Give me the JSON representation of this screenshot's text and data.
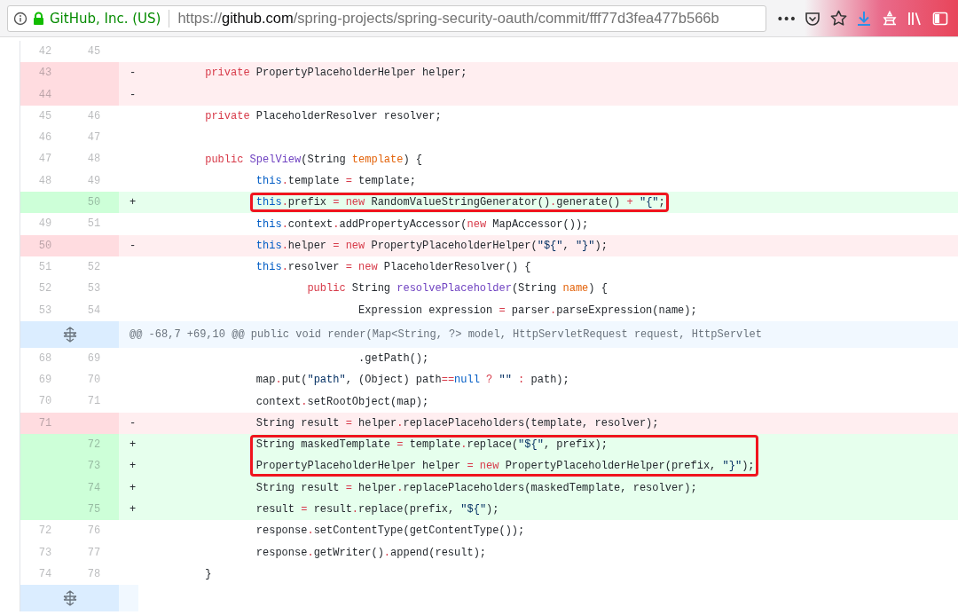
{
  "browser": {
    "site_identity": "GitHub, Inc. (US)",
    "url": "https://**github.com**/spring-projects/spring-security-oauth/commit/fff77d3fea477b566b",
    "menu_glyph": "•••"
  },
  "diff": {
    "lines": [
      {
        "kind": "context",
        "old": "42",
        "new": "45"
      },
      {
        "kind": "del",
        "old": "43",
        "sign": "-",
        "boxed": false,
        "tokens": [
          {
            "kind": "kw",
            "text": "\tprivate"
          },
          {
            "kind": "plain",
            "text": " PropertyPlaceholderHelper helper;"
          }
        ]
      },
      {
        "kind": "del",
        "old": "44",
        "sign": "-"
      },
      {
        "kind": "context",
        "old": "45",
        "new": "46",
        "boxed": false,
        "tokens": [
          {
            "kind": "kw",
            "text": "\tprivate"
          },
          {
            "kind": "plain",
            "text": " PlaceholderResolver resolver;"
          }
        ]
      },
      {
        "kind": "context",
        "old": "46",
        "new": "47"
      },
      {
        "kind": "context",
        "old": "47",
        "new": "48",
        "boxed": false,
        "tokens": [
          {
            "kind": "kw",
            "text": "\tpublic"
          },
          {
            "kind": "entity",
            "text": " SpelView"
          },
          {
            "kind": "plain",
            "text": "(String "
          },
          {
            "kind": "var",
            "text": "template"
          },
          {
            "kind": "plain",
            "text": ") {"
          }
        ]
      },
      {
        "kind": "context",
        "old": "48",
        "new": "49",
        "boxed": false,
        "tokens": [
          {
            "kind": "const",
            "text": "\t\tthis"
          },
          {
            "kind": "kw",
            "text": "."
          },
          {
            "kind": "plain",
            "text": "template "
          },
          {
            "kind": "kw",
            "text": "="
          },
          {
            "kind": "plain",
            "text": " template;"
          }
        ]
      },
      {
        "kind": "add",
        "new": "50",
        "sign": "+",
        "boxed": true,
        "tokens": [
          {
            "kind": "const",
            "text": "\t\tthis"
          },
          {
            "kind": "kw",
            "text": "."
          },
          {
            "kind": "plain",
            "text": "prefix "
          },
          {
            "kind": "kw",
            "text": "= new"
          },
          {
            "kind": "plain",
            "text": " RandomValueStringGenerator()"
          },
          {
            "kind": "kw",
            "text": "."
          },
          {
            "kind": "plain",
            "text": "generate() "
          },
          {
            "kind": "kw",
            "text": "+"
          },
          {
            "kind": "str",
            "text": " \"{\""
          },
          {
            "kind": "plain",
            "text": ";"
          }
        ]
      },
      {
        "kind": "context",
        "old": "49",
        "new": "51",
        "boxed": false,
        "tokens": [
          {
            "kind": "const",
            "text": "\t\tthis"
          },
          {
            "kind": "kw",
            "text": "."
          },
          {
            "kind": "plain",
            "text": "context"
          },
          {
            "kind": "kw",
            "text": "."
          },
          {
            "kind": "plain",
            "text": "addPropertyAccessor("
          },
          {
            "kind": "kw",
            "text": "new"
          },
          {
            "kind": "plain",
            "text": " MapAccessor());"
          }
        ]
      },
      {
        "kind": "del",
        "old": "50",
        "sign": "-",
        "boxed": false,
        "tokens": [
          {
            "kind": "const",
            "text": "\t\tthis"
          },
          {
            "kind": "kw",
            "text": "."
          },
          {
            "kind": "plain",
            "text": "helper "
          },
          {
            "kind": "kw",
            "text": "= new"
          },
          {
            "kind": "plain",
            "text": " PropertyPlaceholderHelper("
          },
          {
            "kind": "str",
            "text": "\"${\""
          },
          {
            "kind": "plain",
            "text": ", "
          },
          {
            "kind": "str",
            "text": "\"}\""
          },
          {
            "kind": "plain",
            "text": ");"
          }
        ]
      },
      {
        "kind": "context",
        "old": "51",
        "new": "52",
        "boxed": false,
        "tokens": [
          {
            "kind": "const",
            "text": "\t\tthis"
          },
          {
            "kind": "kw",
            "text": "."
          },
          {
            "kind": "plain",
            "text": "resolver "
          },
          {
            "kind": "kw",
            "text": "= new"
          },
          {
            "kind": "plain",
            "text": " PlaceholderResolver() {"
          }
        ]
      },
      {
        "kind": "context",
        "old": "52",
        "new": "53",
        "boxed": false,
        "tokens": [
          {
            "kind": "kw",
            "text": "\t\t\tpublic"
          },
          {
            "kind": "plain",
            "text": " String "
          },
          {
            "kind": "entity",
            "text": "resolvePlaceholder"
          },
          {
            "kind": "plain",
            "text": "(String "
          },
          {
            "kind": "var",
            "text": "name"
          },
          {
            "kind": "plain",
            "text": ") {"
          }
        ]
      },
      {
        "kind": "context",
        "old": "53",
        "new": "54",
        "boxed": false,
        "tokens": [
          {
            "kind": "plain",
            "text": "\t\t\t\tExpression expression "
          },
          {
            "kind": "kw",
            "text": "="
          },
          {
            "kind": "plain",
            "text": " parser"
          },
          {
            "kind": "kw",
            "text": "."
          },
          {
            "kind": "plain",
            "text": "parseExpression(name);"
          }
        ]
      },
      {
        "kind": "hunk",
        "header": "@@ -68,7 +69,10 @@ public void render(Map<String, ?> model, HttpServletRequest request, HttpServlet"
      },
      {
        "kind": "context",
        "old": "68",
        "new": "69",
        "boxed": false,
        "tokens": [
          {
            "kind": "plain",
            "text": "\t\t\t\t.getPath();"
          }
        ]
      },
      {
        "kind": "context",
        "old": "69",
        "new": "70",
        "boxed": false,
        "tokens": [
          {
            "kind": "plain",
            "text": "\t\tmap"
          },
          {
            "kind": "kw",
            "text": "."
          },
          {
            "kind": "plain",
            "text": "put("
          },
          {
            "kind": "str",
            "text": "\"path\""
          },
          {
            "kind": "plain",
            "text": ", (Object) path"
          },
          {
            "kind": "kw",
            "text": "=="
          },
          {
            "kind": "const",
            "text": "null"
          },
          {
            "kind": "kw",
            "text": " ?"
          },
          {
            "kind": "str",
            "text": " \"\""
          },
          {
            "kind": "kw",
            "text": " :"
          },
          {
            "kind": "plain",
            "text": " path);"
          }
        ]
      },
      {
        "kind": "context",
        "old": "70",
        "new": "71",
        "boxed": false,
        "tokens": [
          {
            "kind": "plain",
            "text": "\t\tcontext"
          },
          {
            "kind": "kw",
            "text": "."
          },
          {
            "kind": "plain",
            "text": "setRootObject(map);"
          }
        ]
      },
      {
        "kind": "del",
        "old": "71",
        "sign": "-",
        "boxed": false,
        "tokens": [
          {
            "kind": "plain",
            "text": "\t\tString result "
          },
          {
            "kind": "kw",
            "text": "="
          },
          {
            "kind": "plain",
            "text": " helper"
          },
          {
            "kind": "kw",
            "text": "."
          },
          {
            "kind": "plain",
            "text": "replacePlaceholders(template, resolver);"
          }
        ]
      },
      {
        "kind": "add",
        "new": "72",
        "sign": "+",
        "boxed": true,
        "tokens": [
          {
            "kind": "plain",
            "text": "\t\tString maskedTemplate "
          },
          {
            "kind": "kw",
            "text": "="
          },
          {
            "kind": "plain",
            "text": " template"
          },
          {
            "kind": "kw",
            "text": "."
          },
          {
            "kind": "plain",
            "text": "replace("
          },
          {
            "kind": "str",
            "text": "\"${\""
          },
          {
            "kind": "plain",
            "text": ", prefix);"
          }
        ]
      },
      {
        "kind": "add",
        "new": "73",
        "sign": "+",
        "boxed": true,
        "tokens": [
          {
            "kind": "plain",
            "text": "\t\tPropertyPlaceholderHelper helper "
          },
          {
            "kind": "kw",
            "text": "= new"
          },
          {
            "kind": "plain",
            "text": " PropertyPlaceholderHelper(prefix, "
          },
          {
            "kind": "str",
            "text": "\"}\""
          },
          {
            "kind": "plain",
            "text": ");"
          }
        ]
      },
      {
        "kind": "add",
        "new": "74",
        "sign": "+",
        "boxed": false,
        "tokens": [
          {
            "kind": "plain",
            "text": "\t\tString result "
          },
          {
            "kind": "kw",
            "text": "="
          },
          {
            "kind": "plain",
            "text": " helper"
          },
          {
            "kind": "kw",
            "text": "."
          },
          {
            "kind": "plain",
            "text": "replacePlaceholders(maskedTemplate, resolver);"
          }
        ]
      },
      {
        "kind": "add",
        "new": "75",
        "sign": "+",
        "boxed": false,
        "tokens": [
          {
            "kind": "plain",
            "text": "\t\tresult "
          },
          {
            "kind": "kw",
            "text": "="
          },
          {
            "kind": "plain",
            "text": " result"
          },
          {
            "kind": "kw",
            "text": "."
          },
          {
            "kind": "plain",
            "text": "replace(prefix, "
          },
          {
            "kind": "str",
            "text": "\"${\""
          },
          {
            "kind": "plain",
            "text": ");"
          }
        ]
      },
      {
        "kind": "context",
        "old": "72",
        "new": "76",
        "boxed": false,
        "tokens": [
          {
            "kind": "plain",
            "text": "\t\tresponse"
          },
          {
            "kind": "kw",
            "text": "."
          },
          {
            "kind": "plain",
            "text": "setContentType(getContentType());"
          }
        ]
      },
      {
        "kind": "context",
        "old": "73",
        "new": "77",
        "boxed": false,
        "tokens": [
          {
            "kind": "plain",
            "text": "\t\tresponse"
          },
          {
            "kind": "kw",
            "text": "."
          },
          {
            "kind": "plain",
            "text": "getWriter()"
          },
          {
            "kind": "kw",
            "text": "."
          },
          {
            "kind": "plain",
            "text": "append(result);"
          }
        ]
      },
      {
        "kind": "context",
        "old": "74",
        "new": "78",
        "boxed": false,
        "tokens": [
          {
            "kind": "plain",
            "text": "\t}"
          }
        ]
      },
      {
        "kind": "expand"
      }
    ]
  }
}
